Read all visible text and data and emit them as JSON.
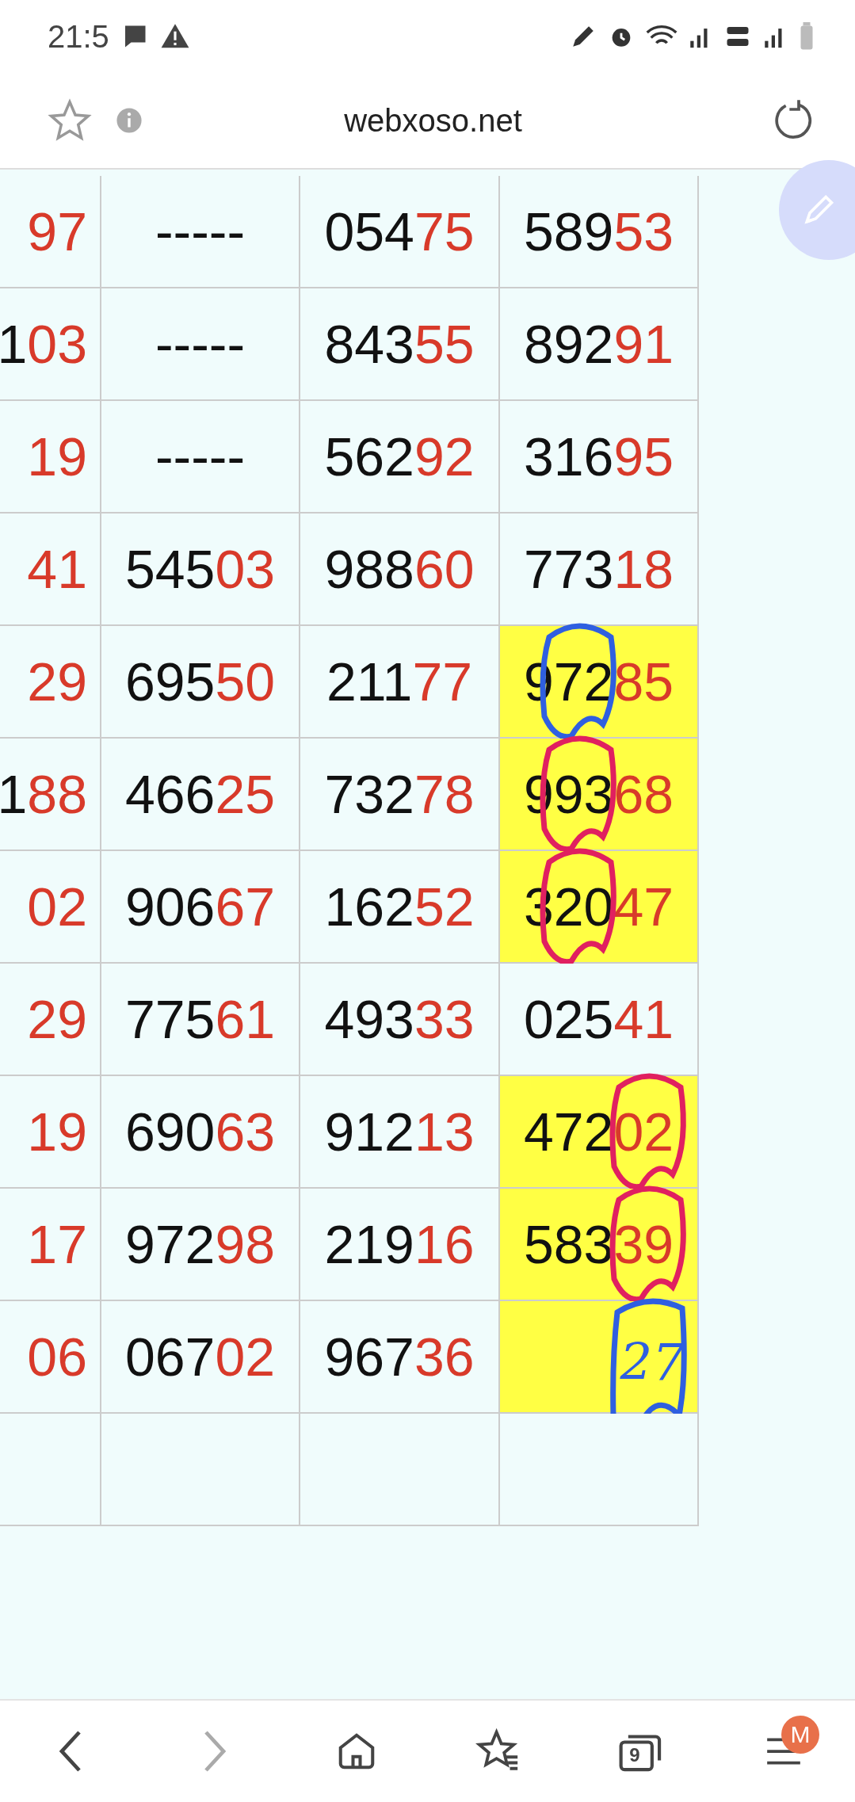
{
  "status_bar": {
    "time": "21:5"
  },
  "address_bar": {
    "url": "webxoso.net"
  },
  "table": {
    "rows": [
      {
        "cells": [
          {
            "tail": "97",
            "highlighted": false
          },
          {
            "head": "-----",
            "highlighted": false
          },
          {
            "head": "054",
            "tail": "75",
            "highlighted": false
          },
          {
            "head": "589",
            "tail": "53",
            "highlighted": false
          }
        ]
      },
      {
        "cells": [
          {
            "head": "1",
            "tail": "03",
            "highlighted": false
          },
          {
            "head": "-----",
            "highlighted": false
          },
          {
            "head": "843",
            "tail": "55",
            "highlighted": false
          },
          {
            "head": "892",
            "tail": "91",
            "highlighted": false
          }
        ]
      },
      {
        "cells": [
          {
            "tail": "19",
            "highlighted": false
          },
          {
            "head": "-----",
            "highlighted": false
          },
          {
            "head": "562",
            "tail": "92",
            "highlighted": false
          },
          {
            "head": "316",
            "tail": "95",
            "highlighted": false
          }
        ]
      },
      {
        "cells": [
          {
            "tail": "41",
            "highlighted": false
          },
          {
            "head": "545",
            "tail": "03",
            "highlighted": false
          },
          {
            "head": "988",
            "tail": "60",
            "highlighted": false
          },
          {
            "head": "773",
            "tail": "18",
            "highlighted": false
          }
        ]
      },
      {
        "cells": [
          {
            "tail": "29",
            "highlighted": false
          },
          {
            "head": "695",
            "tail": "50",
            "highlighted": false
          },
          {
            "head": "211",
            "tail": "77",
            "highlighted": false
          },
          {
            "head": "972",
            "tail": "85",
            "highlighted": true,
            "mark": {
              "color": "#2f5fe0",
              "kind": "head"
            }
          }
        ]
      },
      {
        "cells": [
          {
            "head": "1",
            "tail": "88",
            "highlighted": false
          },
          {
            "head": "466",
            "tail": "25",
            "highlighted": false
          },
          {
            "head": "732",
            "tail": "78",
            "highlighted": false
          },
          {
            "head": "993",
            "tail": "68",
            "highlighted": true,
            "mark": {
              "color": "#e02060",
              "kind": "head"
            }
          }
        ]
      },
      {
        "cells": [
          {
            "tail": "02",
            "highlighted": false
          },
          {
            "head": "906",
            "tail": "67",
            "highlighted": false
          },
          {
            "head": "162",
            "tail": "52",
            "highlighted": false
          },
          {
            "head": "320",
            "tail": "47",
            "highlighted": true,
            "mark": {
              "color": "#e02060",
              "kind": "head"
            }
          }
        ]
      },
      {
        "cells": [
          {
            "tail": "29",
            "highlighted": false
          },
          {
            "head": "775",
            "tail": "61",
            "highlighted": false
          },
          {
            "head": "493",
            "tail": "33",
            "highlighted": false
          },
          {
            "head": "025",
            "tail": "41",
            "highlighted": false
          }
        ]
      },
      {
        "cells": [
          {
            "tail": "19",
            "highlighted": false
          },
          {
            "head": "690",
            "tail": "63",
            "highlighted": false
          },
          {
            "head": "912",
            "tail": "13",
            "highlighted": false
          },
          {
            "head": "472",
            "tail": "02",
            "highlighted": true,
            "mark": {
              "color": "#e02060",
              "kind": "tail"
            }
          }
        ]
      },
      {
        "cells": [
          {
            "tail": "17",
            "highlighted": false
          },
          {
            "head": "972",
            "tail": "98",
            "highlighted": false
          },
          {
            "head": "219",
            "tail": "16",
            "highlighted": false
          },
          {
            "head": "583",
            "tail": "39",
            "highlighted": true,
            "mark": {
              "color": "#e02060",
              "kind": "tail"
            }
          }
        ]
      },
      {
        "cells": [
          {
            "tail": "06",
            "highlighted": false
          },
          {
            "head": "067",
            "tail": "02",
            "highlighted": false
          },
          {
            "head": "967",
            "tail": "36",
            "highlighted": false
          },
          {
            "highlighted": true,
            "note": "27",
            "mark": {
              "color": "#2f5fe0",
              "kind": "tail"
            }
          }
        ]
      },
      {
        "cells": [
          {
            "highlighted": false
          },
          {
            "highlighted": false
          },
          {
            "highlighted": false
          },
          {
            "highlighted": false
          }
        ]
      }
    ]
  },
  "bottom_nav": {
    "tab_count": "9",
    "account_badge": "M"
  }
}
